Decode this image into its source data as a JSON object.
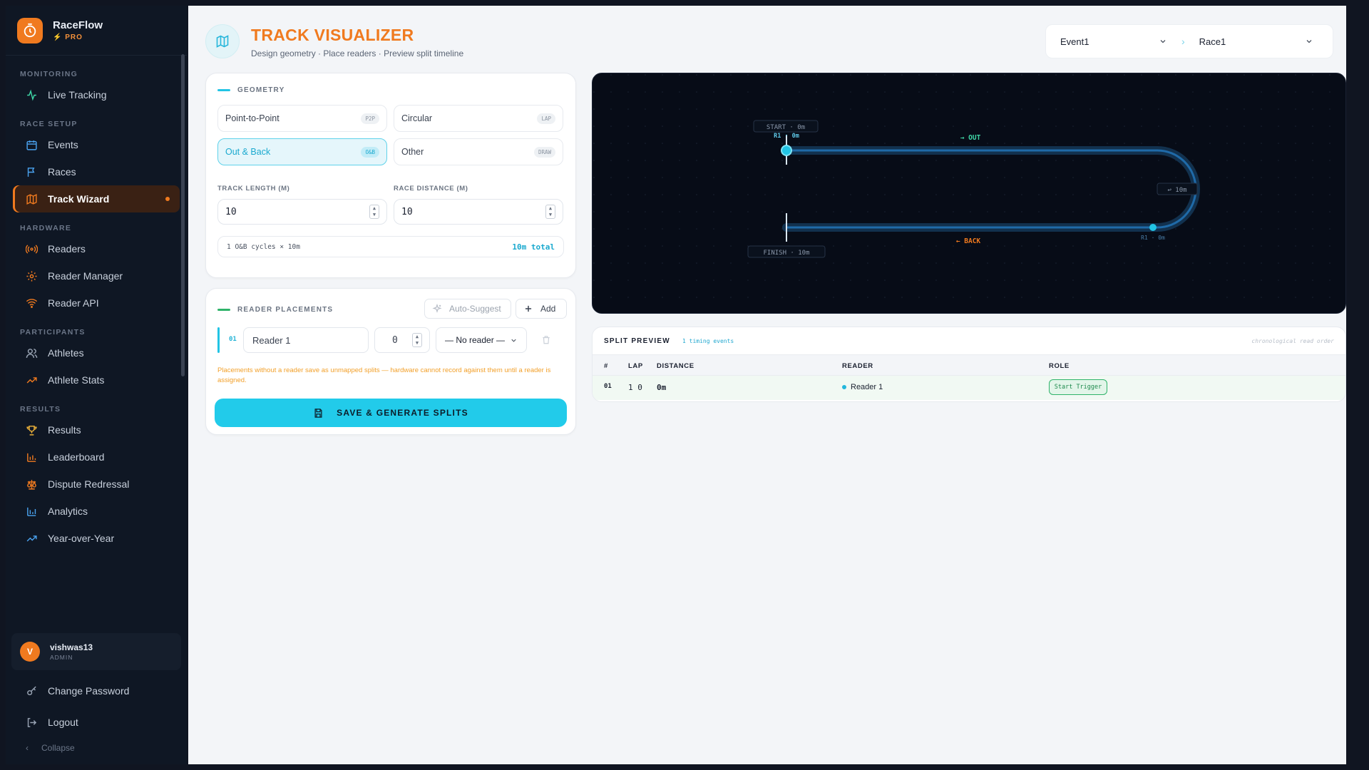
{
  "app": {
    "name": "RaceFlow",
    "tier": "PRO"
  },
  "sidebar": {
    "sections": {
      "monitoring": "MONITORING",
      "race_setup": "RACE SETUP",
      "hardware": "HARDWARE",
      "participants": "PARTICIPANTS",
      "results": "RESULTS"
    },
    "items": {
      "live_tracking": "Live Tracking",
      "events": "Events",
      "races": "Races",
      "track_wizard": "Track Wizard",
      "readers": "Readers",
      "reader_manager": "Reader Manager",
      "reader_api": "Reader API",
      "athletes": "Athletes",
      "athlete_stats": "Athlete Stats",
      "results": "Results",
      "leaderboard": "Leaderboard",
      "dispute": "Dispute Redressal",
      "analytics": "Analytics",
      "yoy": "Year-over-Year"
    },
    "user": {
      "initial": "V",
      "name": "vishwas13",
      "role": "ADMIN"
    },
    "change_password": "Change Password",
    "logout": "Logout",
    "collapse": "Collapse"
  },
  "header": {
    "title": "TRACK VISUALIZER",
    "subtitle": "Design geometry · Place readers · Preview split timeline",
    "event": "Event1",
    "race": "Race1"
  },
  "geometry": {
    "title": "GEOMETRY",
    "options": [
      {
        "label": "Point-to-Point",
        "tag": "P2P"
      },
      {
        "label": "Circular",
        "tag": "LAP"
      },
      {
        "label": "Out & Back",
        "tag": "O&B",
        "selected": true
      },
      {
        "label": "Other",
        "tag": "DRAW"
      }
    ],
    "track_length_label": "TRACK LENGTH (M)",
    "track_length": "10",
    "race_distance_label": "RACE DISTANCE (M)",
    "race_distance": "10",
    "summary": "1 O&B cycles × 10m",
    "total": "10m total"
  },
  "placements": {
    "title": "READER PLACEMENTS",
    "auto_suggest": "Auto-Suggest",
    "add": "Add",
    "rows": [
      {
        "num": "01",
        "name": "Reader 1",
        "distance": "0",
        "reader": "— No reader —"
      }
    ],
    "warning": "Placements without a reader save as unmapped splits — hardware cannot record against them until a reader is assigned.",
    "save": "SAVE & GENERATE SPLITS"
  },
  "viz": {
    "start": "START · 0m",
    "start_reader": "R1 · 0m",
    "out": "→ OUT",
    "turn": "↩ 10m",
    "back": "← BACK",
    "end_reader": "R1 · 0m",
    "finish": "FINISH · 10m"
  },
  "split_preview": {
    "title": "SPLIT PREVIEW",
    "count": "1 timing events",
    "note": "chronological read order",
    "columns": {
      "num": "#",
      "lap": "LAP",
      "distance": "DISTANCE",
      "reader": "READER",
      "role": "ROLE"
    },
    "rows": [
      {
        "num": "01",
        "lap": "1 0",
        "distance": "0m",
        "reader": "Reader 1",
        "role": "Start Trigger"
      }
    ]
  },
  "colors": {
    "accent": "#f07a1f",
    "cyan": "#22cbea",
    "sidebar": "#0f1724"
  }
}
